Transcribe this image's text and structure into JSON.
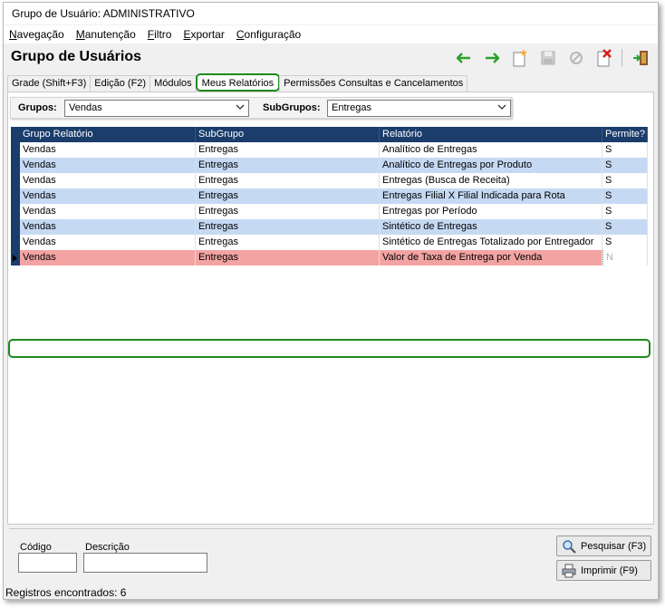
{
  "window": {
    "title": "Grupo de Usuário: ADMINISTRATIVO"
  },
  "menu": [
    {
      "label": "Navegação",
      "u": "N",
      "rest": "avegação"
    },
    {
      "label": "Manutenção",
      "u": "M",
      "rest": "anutenção"
    },
    {
      "label": "Filtro",
      "u": "F",
      "rest": "iltro"
    },
    {
      "label": "Exportar",
      "u": "E",
      "rest": "xportar"
    },
    {
      "label": "Configuração",
      "u": "C",
      "rest": "onfiguração"
    }
  ],
  "page_title": "Grupo de Usuários",
  "toolbar": {
    "icons": [
      "arrow-left-icon",
      "arrow-right-icon",
      "new-document-icon",
      "save-icon",
      "cancel-icon",
      "delete-icon",
      "exit-icon"
    ],
    "colors": {
      "arrow": "#2aa12a",
      "new": "#f5a623",
      "delete": "#d62020"
    }
  },
  "tabs": [
    {
      "label": "Grade (Shift+F3)",
      "active": false
    },
    {
      "label": "Edição (F2)",
      "active": false
    },
    {
      "label": "Módulos",
      "active": false
    },
    {
      "label": "Meus Relatórios",
      "active": true
    },
    {
      "label": "Permissões Consultas e Cancelamentos",
      "active": false
    }
  ],
  "filters": {
    "grupos_label": "Grupos:",
    "grupos_value": "Vendas",
    "subgrupos_label": "SubGrupos:",
    "subgrupos_value": "Entregas"
  },
  "grid": {
    "columns": [
      "Grupo Relatório",
      "SubGrupo",
      "Relatório",
      "Permite?"
    ],
    "rows": [
      [
        "Vendas",
        "Entregas",
        "Analítico de Entregas",
        "S"
      ],
      [
        "Vendas",
        "Entregas",
        "Analítico de Entregas por Produto",
        "S"
      ],
      [
        "Vendas",
        "Entregas",
        "Entregas (Busca de Receita)",
        "S"
      ],
      [
        "Vendas",
        "Entregas",
        "Entregas Filial X Filial Indicada para Rota",
        "S"
      ],
      [
        "Vendas",
        "Entregas",
        "Entregas por Período",
        "S"
      ],
      [
        "Vendas",
        "Entregas",
        "Sintético de Entregas",
        "S"
      ],
      [
        "Vendas",
        "Entregas",
        "Sintético de Entregas Totalizado por Entregador",
        "S"
      ],
      [
        "Vendas",
        "Entregas",
        "Valor de Taxa de Entrega por Venda",
        "N"
      ]
    ],
    "selected_row": 7,
    "colors": {
      "header": "#1a3d6b",
      "alt": "#c5d9f3",
      "selected": "#f4a3a3",
      "highlight": "#1e8a1e"
    }
  },
  "bottom": {
    "codigo_label": "Código",
    "descricao_label": "Descrição",
    "codigo_value": "",
    "descricao_value": "",
    "pesquisar_label": "Pesquisar (F3)",
    "imprimir_label": "Imprimir (F9)"
  },
  "status": "Registros encontrados: 6"
}
